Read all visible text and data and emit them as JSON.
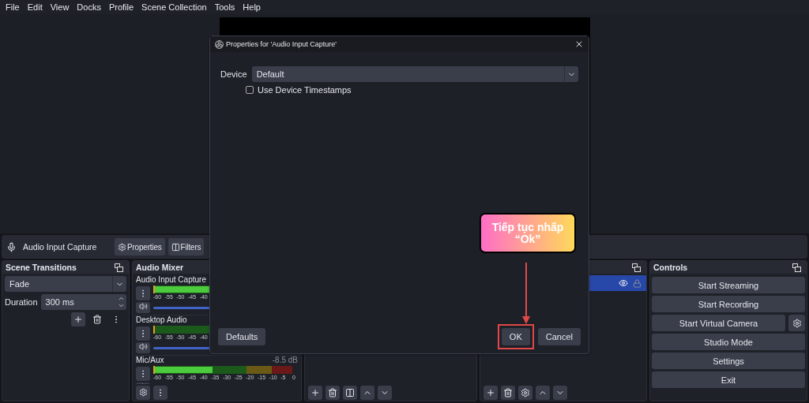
{
  "menu_bar": [
    "File",
    "Edit",
    "View",
    "Docks",
    "Profile",
    "Scene Collection",
    "Tools",
    "Help"
  ],
  "source_toolbar": {
    "source_name": "Audio Input Capture",
    "buttons": [
      {
        "label": "Properties",
        "kind": "properties"
      },
      {
        "label": "Filters",
        "kind": "filters"
      }
    ]
  },
  "scene_transitions": {
    "title": "Scene Transitions",
    "transition": "Fade",
    "duration_label": "Duration",
    "duration": "300 ms"
  },
  "audio_mixer": {
    "title": "Audio Mixer",
    "channels": [
      {
        "name": "Audio Input Capture",
        "level": 0.45,
        "ticks": [
          "-60",
          "-55",
          "-50",
          "-45",
          "-40"
        ]
      },
      {
        "name": "Desktop Audio",
        "ticks": [
          "-60",
          "-55",
          "-50",
          "-45",
          "-40"
        ]
      },
      {
        "name": "Mic/Aux",
        "reading": "-8.5 dB",
        "level": 0.42,
        "ticks": [
          "-60",
          "-55",
          "-50",
          "-45",
          "-40",
          "-35",
          "-30",
          "-25",
          "-20",
          "-15",
          "-10",
          "-5",
          "0"
        ]
      }
    ]
  },
  "sources": {
    "items": [
      {
        "selected": true,
        "visible": true,
        "locked": false
      }
    ]
  },
  "controls": {
    "title": "Controls",
    "buttons": [
      {
        "label": "Start Streaming",
        "kind": "plain"
      },
      {
        "label": "Start Recording",
        "kind": "plain"
      },
      {
        "label": "Start Virtual Camera",
        "kind": "with_settings"
      },
      {
        "label": "Studio Mode",
        "kind": "plain"
      },
      {
        "label": "Settings",
        "kind": "plain"
      },
      {
        "label": "Exit",
        "kind": "plain"
      }
    ]
  },
  "dialog": {
    "title": "Properties for 'Audio Input Capture'",
    "device_label": "Device",
    "device_value": "Default",
    "checkbox": {
      "label": "Use Device Timestamps",
      "checked": false
    },
    "buttons": [
      {
        "label": "Defaults",
        "kind": "left",
        "highlighted": false
      },
      {
        "label": "OK",
        "kind": "right",
        "highlighted": true
      },
      {
        "label": "Cancel",
        "kind": "right",
        "highlighted": false
      }
    ]
  },
  "callout": {
    "text": "Tiếp tục nhấp “Ok”"
  }
}
